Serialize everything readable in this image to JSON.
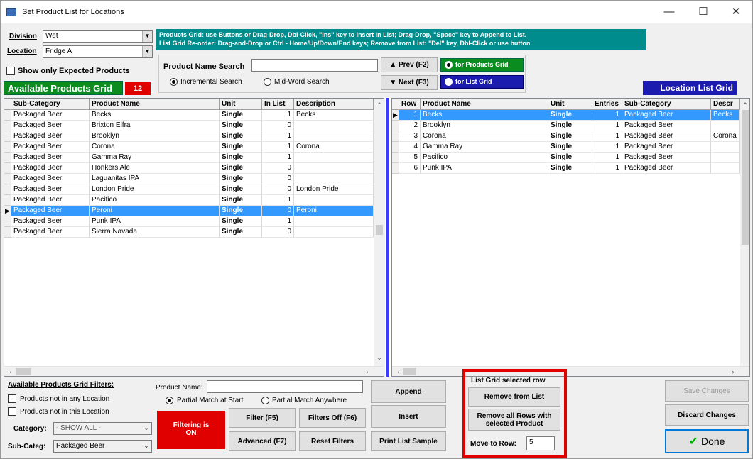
{
  "window": {
    "title": "Set Product List for Locations",
    "minimize": "—",
    "maximize": "☐",
    "close": "✕"
  },
  "division": {
    "label": "Division",
    "value": "Wet"
  },
  "location": {
    "label": "Location",
    "value": "Fridge A"
  },
  "show_expected": {
    "label": "Show only Expected Products",
    "checked": false
  },
  "available_banner": {
    "label": "Available Products Grid",
    "count": "12"
  },
  "info": {
    "line1": "Products Grid: use Buttons or Drag-Drop, Dbl-Click, \"Ins\" key to Insert in List; Drag-Drop, \"Space\" key to Append to List.",
    "line2": "List Grid Re-order: Drag-and-Drop or Ctrl - Home/Up/Down/End keys; Remove from List: \"Del\" key, Dbl-Click or use button."
  },
  "search": {
    "label": "Product Name Search",
    "value": "",
    "incremental": "Incremental Search",
    "midword": "Mid-Word Search",
    "prev": "▲ Prev (F2)",
    "next": "▼ Next (F3)",
    "for_products": "for Products Grid",
    "for_list": "for List Grid"
  },
  "location_list_banner": "Location List Grid",
  "products_grid": {
    "columns": [
      "Sub-Category",
      "Product Name",
      "Unit",
      "In List",
      "Description"
    ],
    "rows": [
      [
        "Packaged Beer",
        "Becks",
        "Single",
        "1",
        "Becks"
      ],
      [
        "Packaged Beer",
        "Brixton Elfra",
        "Single",
        "0",
        ""
      ],
      [
        "Packaged Beer",
        "Brooklyn",
        "Single",
        "1",
        ""
      ],
      [
        "Packaged Beer",
        "Corona",
        "Single",
        "1",
        "Corona"
      ],
      [
        "Packaged Beer",
        "Gamma Ray",
        "Single",
        "1",
        ""
      ],
      [
        "Packaged Beer",
        "Honkers Ale",
        "Single",
        "0",
        ""
      ],
      [
        "Packaged Beer",
        "Laguanitas IPA",
        "Single",
        "0",
        ""
      ],
      [
        "Packaged Beer",
        "London Pride",
        "Single",
        "0",
        "London Pride"
      ],
      [
        "Packaged Beer",
        "Pacifico",
        "Single",
        "1",
        ""
      ],
      [
        "Packaged Beer",
        "Peroni",
        "Single",
        "0",
        "Peroni"
      ],
      [
        "Packaged Beer",
        "Punk IPA",
        "Single",
        "1",
        ""
      ],
      [
        "Packaged Beer",
        "Sierra Navada",
        "Single",
        "0",
        ""
      ]
    ],
    "selected_index": 9
  },
  "list_grid": {
    "columns": [
      "Row",
      "Product Name",
      "Unit",
      "Entries",
      "Sub-Category",
      "Descr"
    ],
    "rows": [
      [
        "1",
        "Becks",
        "Single",
        "1",
        "Packaged Beer",
        "Becks"
      ],
      [
        "2",
        "Brooklyn",
        "Single",
        "1",
        "Packaged Beer",
        ""
      ],
      [
        "3",
        "Corona",
        "Single",
        "1",
        "Packaged Beer",
        "Corona"
      ],
      [
        "4",
        "Gamma Ray",
        "Single",
        "1",
        "Packaged Beer",
        ""
      ],
      [
        "5",
        "Pacifico",
        "Single",
        "1",
        "Packaged Beer",
        ""
      ],
      [
        "6",
        "Punk IPA",
        "Single",
        "1",
        "Packaged Beer",
        ""
      ]
    ],
    "selected_index": 0
  },
  "filters": {
    "title": "Available Products Grid Filters:",
    "not_any_location": "Products not in any Location",
    "not_this_location": "Products not in this Location",
    "category_label": "Category:",
    "category_value": "- SHOW ALL -",
    "subcateg_label": "Sub-Categ:",
    "subcateg_value": "Packaged Beer",
    "product_name_label": "Product Name:",
    "product_name_value": "",
    "partial_start": "Partial Match at Start",
    "partial_anywhere": "Partial Match Anywhere",
    "filtering_status": "Filtering is ON",
    "filter_btn": "Filter (F5)",
    "filters_off_btn": "Filters Off (F6)",
    "advanced_btn": "Advanced (F7)",
    "reset_btn": "Reset Filters"
  },
  "actions": {
    "append": "Append",
    "insert": "Insert",
    "print_sample": "Print List Sample",
    "list_selected_title": "List Grid selected row",
    "remove_from_list": "Remove from List",
    "remove_all_rows": "Remove all Rows with selected Product",
    "move_to_row_label": "Move to Row:",
    "move_to_row_value": "5",
    "save_changes": "Save Changes",
    "discard_changes": "Discard Changes",
    "done": "Done"
  },
  "colors": {
    "accent_green": "#0b8c1e",
    "accent_blue": "#1b1bb0",
    "info_teal": "#008c8c",
    "selection": "#3399ff",
    "highlight_red": "#e00000"
  }
}
